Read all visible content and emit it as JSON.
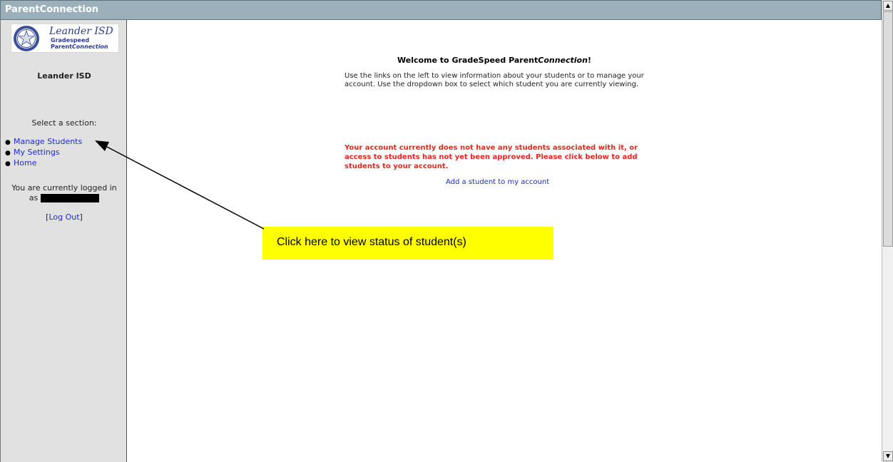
{
  "window": {
    "title": "ParentConnection"
  },
  "logo": {
    "district_script": "Leander ISD",
    "product_line1": "Gradespeed",
    "product_line2_a": "Parent",
    "product_line2_b": "Connection"
  },
  "sidebar": {
    "district_name": "Leander ISD",
    "select_label": "Select a section:",
    "nav_items": [
      {
        "label": "Manage Students"
      },
      {
        "label": "My Settings"
      },
      {
        "label": "Home"
      }
    ],
    "login_line1": "You are currently logged in",
    "login_line2": "as",
    "logout_open": "[",
    "logout_label": "Log Out",
    "logout_close": "]"
  },
  "main": {
    "welcome_prefix": "Welcome to GradeSpeed Parent",
    "welcome_italic": "Connection",
    "welcome_suffix": "!",
    "intro": "Use the links on the left to view information about your students or to manage your account.   Use the dropdown box to select which student you are currently viewing.",
    "warning": "Your account currently does not have any students associated with it, or access to students has not yet been approved. Please click below to add students to your account.",
    "add_student_link": "Add a student to my account"
  },
  "annotation": {
    "callout_text": "Click here to view status of student(s)",
    "callout_color": "#ffff00"
  },
  "colors": {
    "titlebar": "#9bb0ba",
    "sidebar": "#e1e1e1",
    "link": "#1c2cc7",
    "warning": "#e8251e"
  },
  "icons": {
    "logo_seal": "star-seal-icon",
    "scroll_up": "arrow-up-icon",
    "scroll_down": "arrow-down-icon",
    "annotation_arrow": "arrow-pointer-icon"
  }
}
